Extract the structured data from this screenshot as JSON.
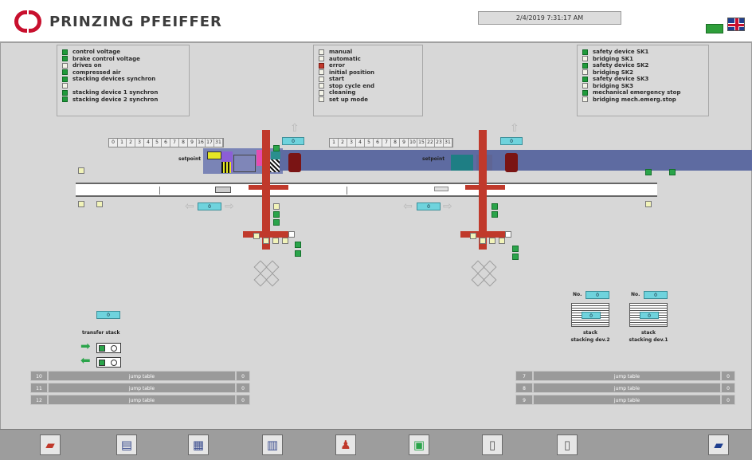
{
  "header": {
    "brand": "PRINZING PFEIFFER",
    "datetime": "2/4/2019 7:31:17 AM",
    "status_color": "#2e9e3a"
  },
  "panels": {
    "left": [
      {
        "label": "control voltage",
        "state": "on"
      },
      {
        "label": "brake control voltage",
        "state": "on"
      },
      {
        "label": "drives on",
        "state": "off"
      },
      {
        "label": "compressed air",
        "state": "on"
      },
      {
        "label": "stacking devices synchron",
        "state": "on"
      },
      {
        "label": "",
        "state": "off"
      },
      {
        "label": "stacking device 1 synchron",
        "state": "on"
      },
      {
        "label": "stacking device 2 synchron",
        "state": "on"
      }
    ],
    "middle": [
      {
        "label": "manual",
        "state": "off"
      },
      {
        "label": "automatic",
        "state": "off"
      },
      {
        "label": "error",
        "state": "err"
      },
      {
        "label": "initial position",
        "state": "off"
      },
      {
        "label": "start",
        "state": "off"
      },
      {
        "label": "stop cycle end",
        "state": "off"
      },
      {
        "label": "cleaning",
        "state": "off"
      },
      {
        "label": "set up mode",
        "state": "off"
      }
    ],
    "right": [
      {
        "label": "safety device SK1",
        "state": "on"
      },
      {
        "label": "bridging SK1",
        "state": "off"
      },
      {
        "label": "safety device SK2",
        "state": "on"
      },
      {
        "label": "bridging SK2",
        "state": "off"
      },
      {
        "label": "safety device SK3",
        "state": "on"
      },
      {
        "label": "bridging SK3",
        "state": "off"
      },
      {
        "label": "mechanical emergency stop",
        "state": "on"
      },
      {
        "label": "bridging mech.emerg.stop",
        "state": "off"
      }
    ]
  },
  "slots_left": [
    "0",
    "1",
    "2",
    "3",
    "4",
    "5",
    "6",
    "7",
    "8",
    "9",
    "16",
    "17",
    "31"
  ],
  "slots_right": [
    "1",
    "2",
    "3",
    "4",
    "5",
    "6",
    "7",
    "8",
    "9",
    "10",
    "15",
    "22",
    "23",
    "31"
  ],
  "process": {
    "setpoint_label": "setpoint",
    "counter_left": "0",
    "counter_right": "0",
    "pos_left": "0",
    "pos_right": "0"
  },
  "transfer": {
    "label": "transfer stack",
    "value": "0"
  },
  "stacks": [
    {
      "no_label": "No.",
      "no": "0",
      "value": "0",
      "name": "stack",
      "sub": "stacking dev.2"
    },
    {
      "no_label": "No.",
      "no": "0",
      "value": "0",
      "name": "stack",
      "sub": "stacking dev.1"
    }
  ],
  "jump_left": [
    {
      "num": "10",
      "label": "jump table",
      "end": "0"
    },
    {
      "num": "11",
      "label": "jump table",
      "end": "0"
    },
    {
      "num": "12",
      "label": "jump table",
      "end": "0"
    }
  ],
  "jump_right": [
    {
      "num": "7",
      "label": "jump table",
      "end": "0"
    },
    {
      "num": "8",
      "label": "jump table",
      "end": "0"
    },
    {
      "num": "9",
      "label": "jump table",
      "end": "0"
    }
  ],
  "toolbar_icons": [
    "eraser-icon",
    "document-icon",
    "info-icon",
    "stack-icon",
    "operator-icon",
    "table-icon",
    "device-up-icon",
    "device-down-icon",
    "folder-icon"
  ]
}
